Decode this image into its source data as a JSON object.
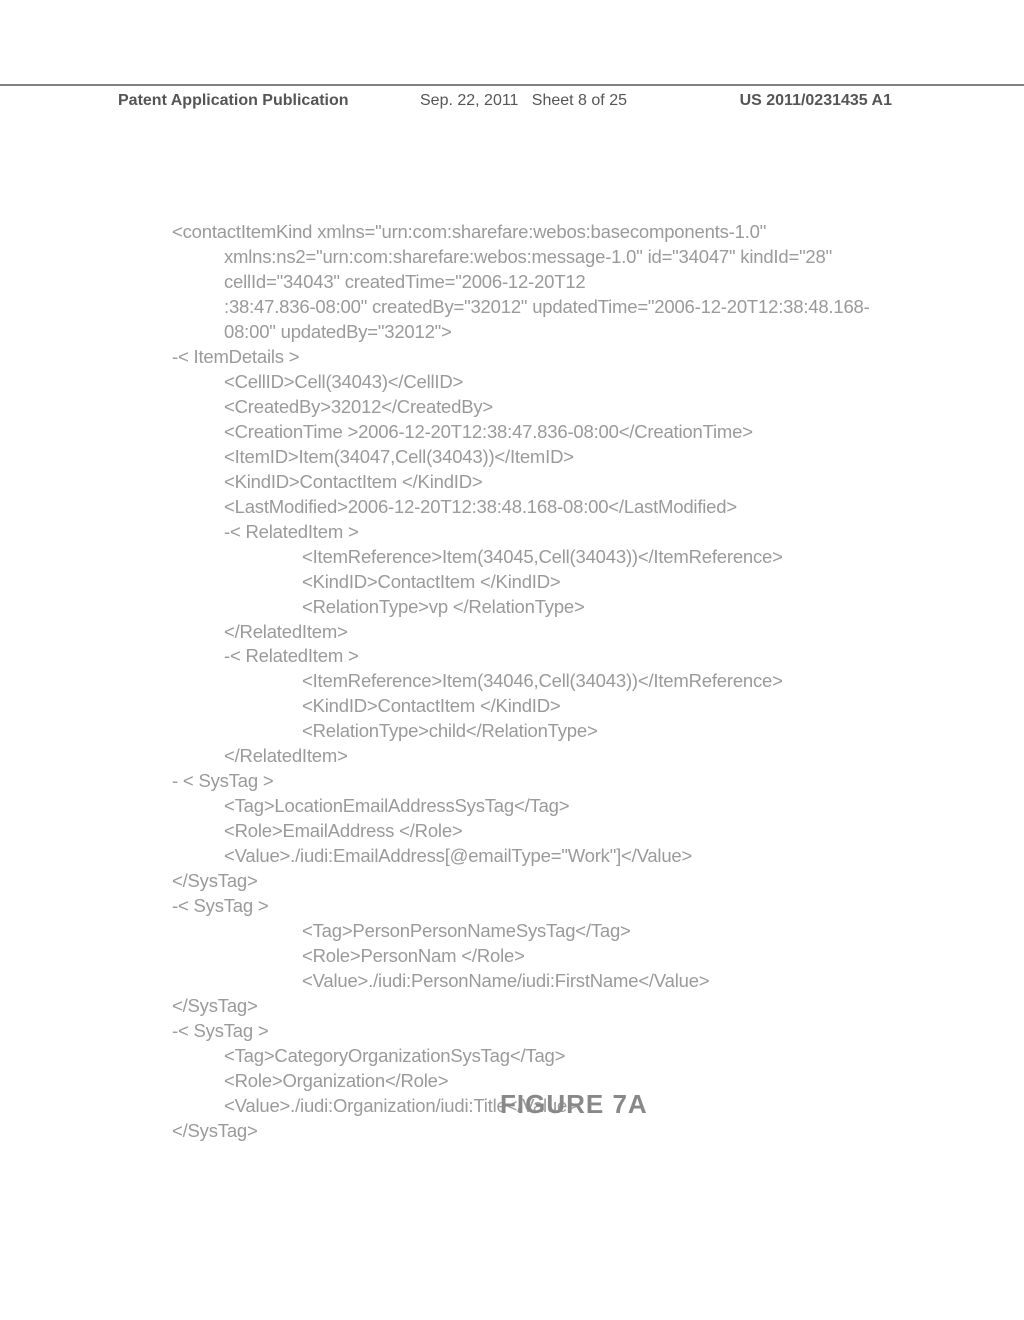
{
  "header": {
    "left": "Patent Application Publication",
    "center_date": "Sep. 22, 2011",
    "center_sheet": "Sheet 8 of 25",
    "right": "US 2011/0231435 A1"
  },
  "figure_label": "FIGURE 7A",
  "lines": [
    {
      "indent": 0,
      "text": "<contactItemKind xmlns=\"urn:com:sharefare:webos:basecomponents-1.0\""
    },
    {
      "indent": 1,
      "text": "xmlns:ns2=\"urn:com:sharefare:webos:message-1.0\" id=\"34047\" kindId=\"28\" cellId=\"34043\" createdTime=\"2006-12-20T12"
    },
    {
      "indent": 1,
      "text": ":38:47.836-08:00\" createdBy=\"32012\" updatedTime=\"2006-12-20T12:38:48.168-08:00\" updatedBy=\"32012\">"
    },
    {
      "indent": 0,
      "text": "-< ItemDetails >"
    },
    {
      "indent": 1,
      "text": "<CellID>Cell(34043)</CellID>"
    },
    {
      "indent": 1,
      "text": "<CreatedBy>32012</CreatedBy>"
    },
    {
      "indent": 1,
      "text": "<CreationTime >2006-12-20T12:38:47.836-08:00</CreationTime>"
    },
    {
      "indent": 1,
      "text": "<ItemID>Item(34047,Cell(34043))</ItemID>"
    },
    {
      "indent": 1,
      "text": "<KindID>ContactItem </KindID>"
    },
    {
      "indent": 1,
      "text": "<LastModified>2006-12-20T12:38:48.168-08:00</LastModified>"
    },
    {
      "indent": 1,
      "text": "-< RelatedItem >"
    },
    {
      "indent": 2,
      "text": "<ItemReference>Item(34045,Cell(34043))</ItemReference>"
    },
    {
      "indent": 2,
      "text": "<KindID>ContactItem </KindID>"
    },
    {
      "indent": 2,
      "text": "<RelationType>vp </RelationType>"
    },
    {
      "indent": 1,
      "text": "</RelatedItem>"
    },
    {
      "indent": 1,
      "text": "-< RelatedItem >"
    },
    {
      "indent": 2,
      "text": "<ItemReference>Item(34046,Cell(34043))</ItemReference>"
    },
    {
      "indent": 2,
      "text": "<KindID>ContactItem </KindID>"
    },
    {
      "indent": 2,
      "text": "<RelationType>child</RelationType>"
    },
    {
      "indent": 1,
      "text": "</RelatedItem>"
    },
    {
      "indent": 0,
      "text": "- < SysTag >"
    },
    {
      "indent": 1,
      "text": "<Tag>LocationEmailAddressSysTag</Tag>"
    },
    {
      "indent": 1,
      "text": "<Role>EmailAddress </Role>"
    },
    {
      "indent": 1,
      "text": "<Value>./iudi:EmailAddress[@emailType=\"Work\"]</Value>"
    },
    {
      "indent": 0,
      "text": "</SysTag>"
    },
    {
      "indent": 0,
      "text": "-< SysTag >"
    },
    {
      "indent": 2,
      "text": "<Tag>PersonPersonNameSysTag</Tag>"
    },
    {
      "indent": 2,
      "text": "<Role>PersonNam </Role>"
    },
    {
      "indent": 2,
      "text": "<Value>./iudi:PersonName/iudi:FirstName</Value>"
    },
    {
      "indent": 0,
      "text": "</SysTag>"
    },
    {
      "indent": 0,
      "text": "-< SysTag >"
    },
    {
      "indent": 1,
      "text": "<Tag>CategoryOrganizationSysTag</Tag>"
    },
    {
      "indent": 1,
      "text": "<Role>Organization</Role>"
    },
    {
      "indent": 1,
      "text": "<Value>./iudi:Organization/iudi:Title</Value>"
    },
    {
      "indent": 0,
      "text": "</SysTag>"
    }
  ]
}
